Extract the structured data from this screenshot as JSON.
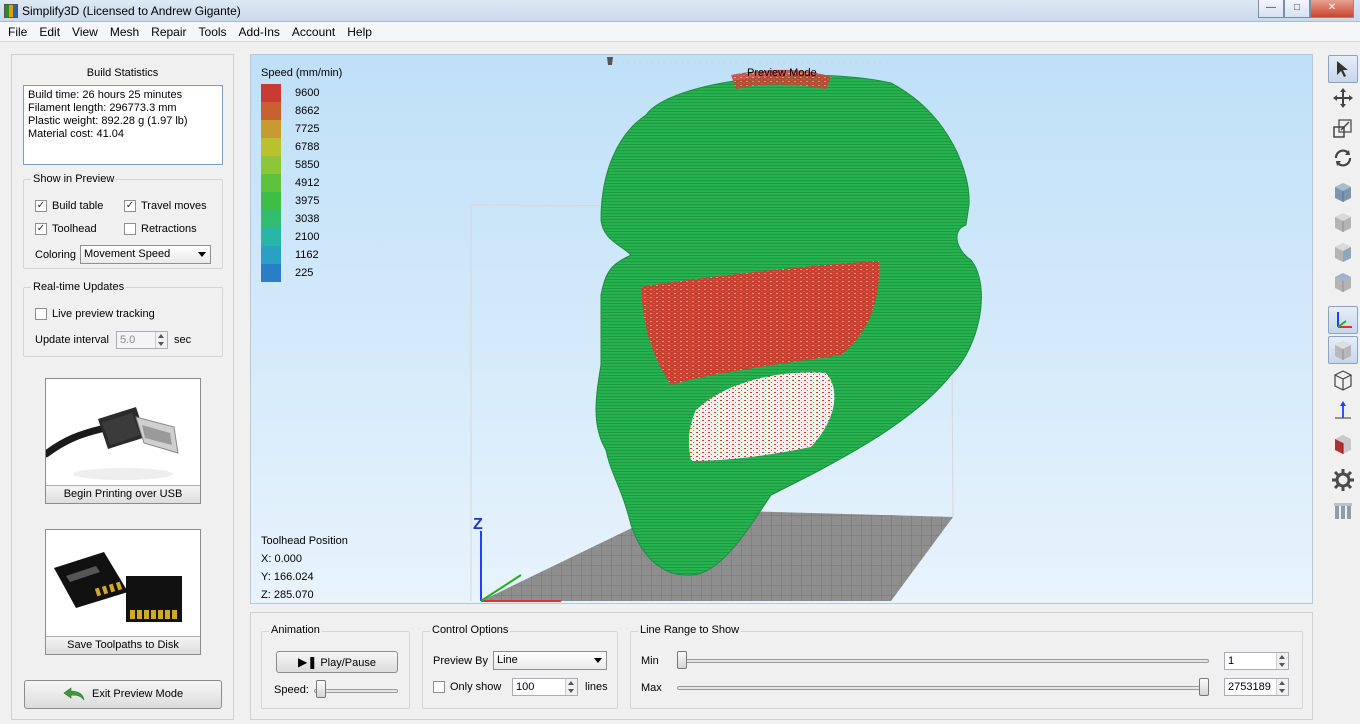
{
  "window": {
    "title": "Simplify3D (Licensed to Andrew Gigante)"
  },
  "menu": [
    "File",
    "Edit",
    "View",
    "Mesh",
    "Repair",
    "Tools",
    "Add-Ins",
    "Account",
    "Help"
  ],
  "build_statistics": {
    "title": "Build Statistics",
    "lines": [
      "Build time: 26 hours 25 minutes",
      "Filament length: 296773.3 mm",
      "Plastic weight: 892.28 g (1.97 lb)",
      "Material cost: 41.04"
    ]
  },
  "show_in_preview": {
    "title": "Show in Preview",
    "build_table": {
      "label": "Build table",
      "checked": true
    },
    "travel_moves": {
      "label": "Travel moves",
      "checked": true
    },
    "toolhead": {
      "label": "Toolhead",
      "checked": true
    },
    "retractions": {
      "label": "Retractions",
      "checked": false
    },
    "coloring_label": "Coloring",
    "coloring_value": "Movement Speed"
  },
  "realtime": {
    "title": "Real-time Updates",
    "live_tracking": {
      "label": "Live preview tracking",
      "checked": false
    },
    "interval_label": "Update interval",
    "interval_value": "5.0",
    "interval_unit": "sec"
  },
  "usb_button": {
    "label": "Begin Printing over USB"
  },
  "disk_button": {
    "label": "Save Toolpaths to Disk"
  },
  "exit_button": {
    "label": "Exit Preview Mode"
  },
  "viewport": {
    "legend_title": "Speed (mm/min)",
    "legend": [
      {
        "value": "9600",
        "color": "#c83a32"
      },
      {
        "value": "8662",
        "color": "#c8602f"
      },
      {
        "value": "7725",
        "color": "#c89a30"
      },
      {
        "value": "6788",
        "color": "#b8c12e"
      },
      {
        "value": "5850",
        "color": "#8cc63a"
      },
      {
        "value": "4912",
        "color": "#5ec23c"
      },
      {
        "value": "3975",
        "color": "#3dbe44"
      },
      {
        "value": "3038",
        "color": "#31be72"
      },
      {
        "value": "2100",
        "color": "#27b7a6"
      },
      {
        "value": "1162",
        "color": "#2aa0c4"
      },
      {
        "value": "225",
        "color": "#2a7ec8"
      }
    ],
    "mode_label": "Preview Mode",
    "axis_label": "Z",
    "toolhead": {
      "title": "Toolhead Position",
      "x": "X: 0.000",
      "y": "Y: 166.024",
      "z": "Z: 285.070"
    }
  },
  "animation": {
    "title": "Animation",
    "play_label": "Play/Pause",
    "speed_label": "Speed:"
  },
  "control_options": {
    "title": "Control Options",
    "preview_by_label": "Preview By",
    "preview_by_value": "Line",
    "only_show": {
      "label": "Only show",
      "checked": false
    },
    "only_show_value": "100",
    "only_show_unit": "lines"
  },
  "line_range": {
    "title": "Line Range to Show",
    "min_label": "Min",
    "min_value": "1",
    "max_label": "Max",
    "max_value": "2753189"
  },
  "toolbar_icons": [
    "select-icon",
    "move-icon",
    "scale-icon",
    "rotate-icon",
    "view-default-icon",
    "view-front-icon",
    "view-side-icon",
    "view-top-icon",
    "axes-icon",
    "solid-view-icon",
    "wireframe-icon",
    "normals-icon",
    "cross-section-icon",
    "settings-gear-icon",
    "supports-icon"
  ]
}
